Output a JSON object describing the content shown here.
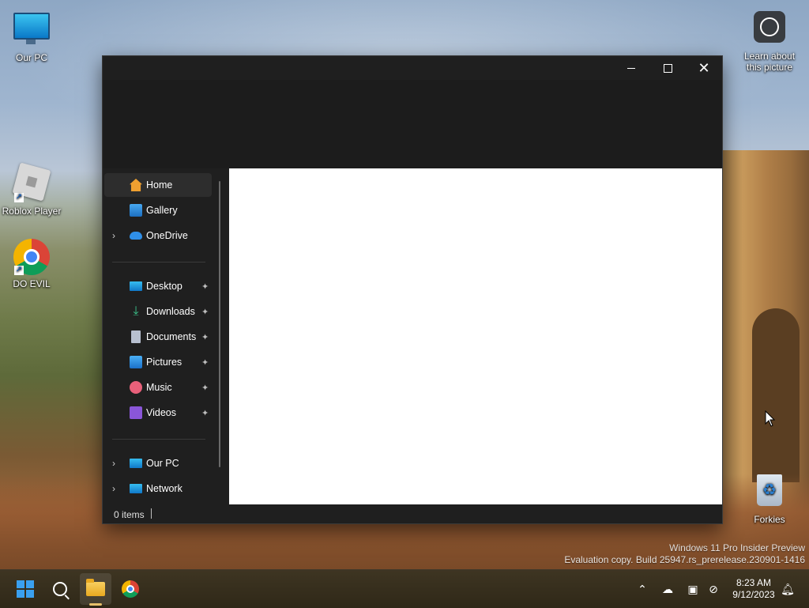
{
  "desktop": {
    "icons": [
      {
        "label": "Our PC"
      },
      {
        "label": "Roblox Player"
      },
      {
        "label": "DO EVIL"
      },
      {
        "label": "Learn about this picture"
      },
      {
        "label": "Forkies"
      }
    ]
  },
  "window": {
    "controls": {
      "minimize": "—",
      "maximize": "☐",
      "close": "✕"
    },
    "nav": {
      "items": [
        {
          "label": "Home",
          "icon": "home-icon",
          "selected": true
        },
        {
          "label": "Gallery",
          "icon": "gallery-icon"
        },
        {
          "label": "OneDrive",
          "icon": "onedrive-icon",
          "expandable": true
        },
        {
          "label": "Desktop",
          "icon": "desktop-icon",
          "pinned": true
        },
        {
          "label": "Downloads",
          "icon": "downloads-icon",
          "pinned": true
        },
        {
          "label": "Documents",
          "icon": "documents-icon",
          "pinned": true
        },
        {
          "label": "Pictures",
          "icon": "pictures-icon",
          "pinned": true
        },
        {
          "label": "Music",
          "icon": "music-icon",
          "pinned": true
        },
        {
          "label": "Videos",
          "icon": "videos-icon",
          "pinned": true
        },
        {
          "label": "Our PC",
          "icon": "pc-icon",
          "expandable": true
        },
        {
          "label": "Network",
          "icon": "network-icon",
          "expandable": true
        }
      ]
    },
    "status": {
      "item_count": "0 items"
    }
  },
  "watermark": {
    "line1": "Windows 11 Pro Insider Preview",
    "line2": "Evaluation copy. Build 25947.rs_prerelease.230901-1416"
  },
  "taskbar": {
    "clock": {
      "time": "8:23 AM",
      "date": "9/12/2023"
    }
  },
  "colors": {
    "window_bg": "#1f1f1f",
    "content_bg": "#ffffff",
    "taskbar_bg": "#2f2818",
    "accent": "#3aa0f0"
  }
}
